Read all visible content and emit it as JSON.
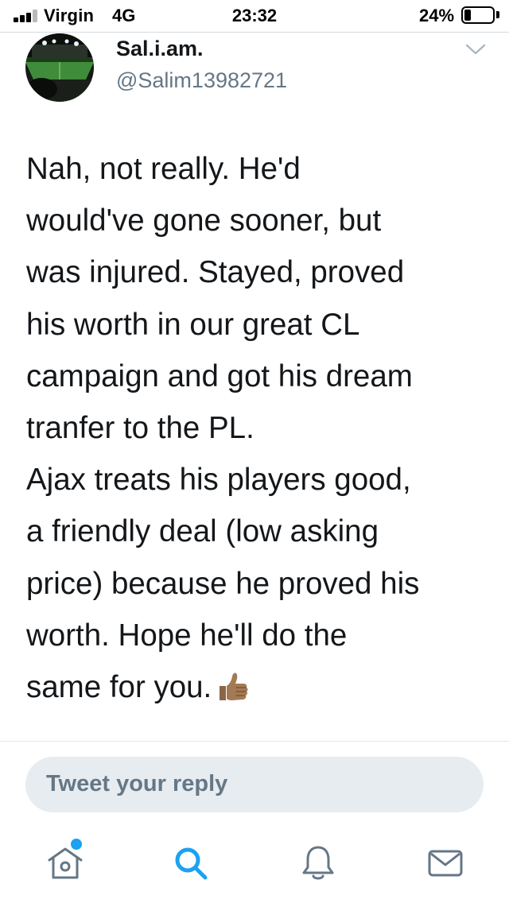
{
  "status_bar": {
    "carrier": "Virgin",
    "network": "4G",
    "time": "23:32",
    "battery_percent_label": "24%",
    "battery_level": 0.24,
    "signal_bars": 3
  },
  "tweet": {
    "display_name": "Sal.i.am.",
    "handle": "@Salim13982721",
    "avatar_icon": "stadium-photo-avatar",
    "menu_icon": "chevron-down-icon",
    "lines": [
      "Nah, not really. He'd",
      "would've gone sooner, but",
      "was injured. Stayed, proved",
      "his worth in our great CL",
      "campaign and got his dream",
      "tranfer to the PL.",
      "Ajax treats his players good,",
      "a friendly deal (low asking",
      "price) because he proved his",
      "worth. Hope he'll do the",
      "same for you."
    ],
    "emoji": "thumbs-up-medium-skin-tone"
  },
  "reply": {
    "placeholder": "Tweet your reply"
  },
  "tab_bar": {
    "items": [
      {
        "icon": "home-icon",
        "has_notification_dot": true,
        "active": false
      },
      {
        "icon": "search-icon",
        "has_notification_dot": false,
        "active": true
      },
      {
        "icon": "bell-icon",
        "has_notification_dot": false,
        "active": false
      },
      {
        "icon": "mail-icon",
        "has_notification_dot": false,
        "active": false
      }
    ]
  },
  "colors": {
    "accent": "#1da1f2",
    "text_primary": "#14171a",
    "text_secondary": "#657786",
    "icon_gray": "#657786",
    "reply_bg": "#e6ecf0"
  }
}
